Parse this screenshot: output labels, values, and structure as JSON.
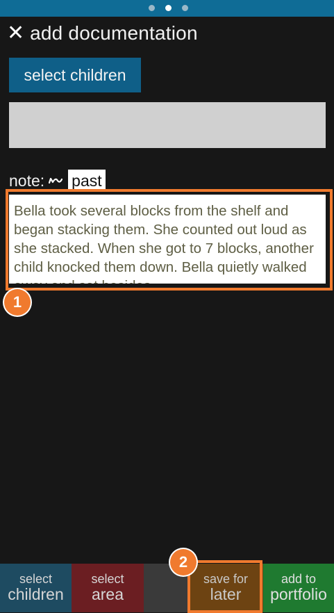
{
  "header": {
    "title": "add documentation",
    "close_icon": "close-icon"
  },
  "pager": {
    "count": 3,
    "active_index": 1
  },
  "select_children_label": "select children",
  "note": {
    "label": "note:",
    "tense": "past",
    "text": "Bella took several blocks from the shelf and began stacking them. She counted out loud as she stacked. When she got to 7 blocks, another child knocked them down. Bella quietly walked away and sat besides"
  },
  "annotations": {
    "badge1": "1",
    "badge2": "2"
  },
  "bottom": {
    "children": {
      "line1": "select",
      "line2": "children"
    },
    "area": {
      "line1": "select",
      "line2": "area"
    },
    "save": {
      "line1": "save for",
      "line2": "later"
    },
    "portfolio": {
      "line1": "add to",
      "line2": "portfolio"
    }
  },
  "colors": {
    "accent_orange": "#f07a2e",
    "top_bar": "#0f6c96",
    "select_blue": "#0f5f88",
    "area_red": "#6b1e22",
    "save_brown": "#6d4312",
    "portfolio_green": "#1f7a30"
  }
}
